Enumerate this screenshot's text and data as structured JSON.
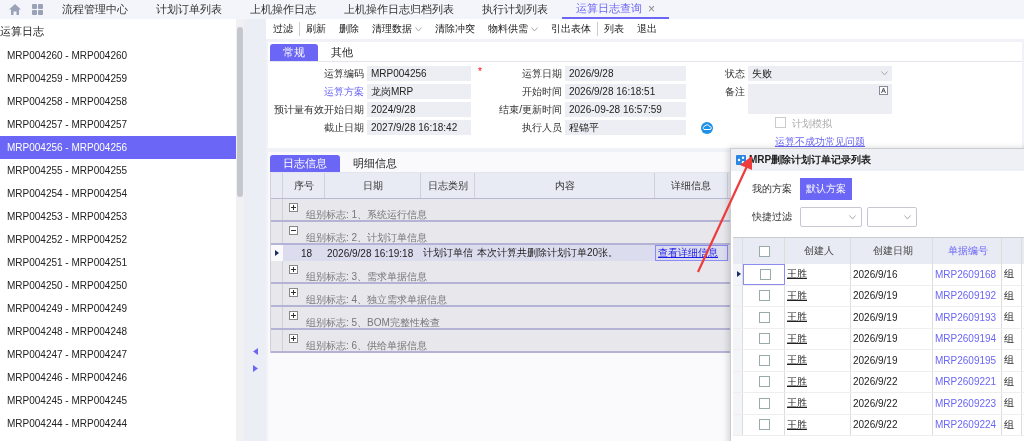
{
  "top_tabs": [
    {
      "label": "流程管理中心",
      "selected": false
    },
    {
      "label": "计划订单列表",
      "selected": false
    },
    {
      "label": "上机操作日志",
      "selected": false
    },
    {
      "label": "上机操作日志归档列表",
      "selected": false
    },
    {
      "label": "执行计划列表",
      "selected": false
    },
    {
      "label": "运算日志查询",
      "selected": true,
      "close": "×"
    }
  ],
  "toolbar": [
    {
      "label": "过滤",
      "dropdown": false,
      "separator_before": false
    },
    {
      "label": "刷新",
      "dropdown": false,
      "separator_before": true
    },
    {
      "label": "删除",
      "dropdown": false,
      "separator_before": false
    },
    {
      "label": "清理数据",
      "dropdown": true,
      "separator_before": false
    },
    {
      "label": "清除冲突",
      "dropdown": false,
      "separator_before": false
    },
    {
      "label": "物料供需",
      "dropdown": true,
      "separator_before": false
    },
    {
      "label": "引出表体",
      "dropdown": false,
      "separator_before": false
    },
    {
      "label": "列表",
      "dropdown": false,
      "separator_before": true
    },
    {
      "label": "退出",
      "dropdown": false,
      "separator_before": false
    }
  ],
  "sidebar": {
    "title": "运算日志",
    "items": [
      {
        "label": "MRP004260 - MRP004260",
        "selected": false
      },
      {
        "label": "MRP004259 - MRP004259",
        "selected": false
      },
      {
        "label": "MRP004258 - MRP004258",
        "selected": false
      },
      {
        "label": "MRP004257 - MRP004257",
        "selected": false
      },
      {
        "label": "MRP004256 - MRP004256",
        "selected": true
      },
      {
        "label": "MRP004255 - MRP004255",
        "selected": false
      },
      {
        "label": "MRP004254 - MRP004254",
        "selected": false
      },
      {
        "label": "MRP004253 - MRP004253",
        "selected": false
      },
      {
        "label": "MRP004252 - MRP004252",
        "selected": false
      },
      {
        "label": "MRP004251 - MRP004251",
        "selected": false
      },
      {
        "label": "MRP004250 - MRP004250",
        "selected": false
      },
      {
        "label": "MRP004249 - MRP004249",
        "selected": false
      },
      {
        "label": "MRP004248 - MRP004248",
        "selected": false
      },
      {
        "label": "MRP004247 - MRP004247",
        "selected": false
      },
      {
        "label": "MRP004246 - MRP004246",
        "selected": false
      },
      {
        "label": "MRP004245 - MRP004245",
        "selected": false
      },
      {
        "label": "MRP004244 - MRP004244",
        "selected": false
      }
    ]
  },
  "form_tabs": [
    {
      "label": "常规",
      "selected": true
    },
    {
      "label": "其他",
      "selected": false
    }
  ],
  "form_columns": [
    [
      {
        "kind": "text",
        "label": "运算编码",
        "value": "MRP004256",
        "required_mark": "*"
      },
      {
        "kind": "text",
        "label": "运算方案",
        "value": "龙岗MRP",
        "link": true
      },
      {
        "kind": "text",
        "label": "预计量有效开始日期",
        "value": "2024/9/28"
      },
      {
        "kind": "text",
        "label": "截止日期",
        "value": "2027/9/28 16:18:42"
      }
    ],
    [
      {
        "kind": "text",
        "label": "运算日期",
        "value": "2026/9/28"
      },
      {
        "kind": "text",
        "label": "开始时间",
        "value": "2026/9/28 16:18:51"
      },
      {
        "kind": "text",
        "label": "结束/更新时间",
        "value": "2026-09-28 16:57:59"
      },
      {
        "kind": "lookup",
        "label": "执行人员",
        "value": "程锦平"
      }
    ],
    [
      {
        "kind": "select",
        "label": "状态",
        "value": "失败"
      },
      {
        "kind": "textarea",
        "label": "备注"
      },
      {
        "kind": "checkbox",
        "label": "计划模拟",
        "checked": false,
        "disabled": true
      },
      {
        "kind": "link",
        "label": "运算不成功常见问题"
      }
    ]
  ],
  "log_tabs": [
    {
      "label": "日志信息",
      "selected": true
    },
    {
      "label": "明细信息",
      "selected": false
    }
  ],
  "log_table": {
    "columns": [
      "序号",
      "日期",
      "日志类别",
      "内容",
      "详细信息"
    ],
    "groups": [
      {
        "label": "组别标志: 1、系统运行信息",
        "expanded": false
      },
      {
        "label": "组别标志: 2、计划订单信息",
        "expanded": true,
        "rows": [
          {
            "seq": "18",
            "date": "2026/9/28 16:19:18",
            "category": "计划订单信",
            "content": "本次计算共删除计划订单20张。",
            "detail": "查看详细信息",
            "current": true
          }
        ]
      },
      {
        "label": "组别标志: 3、需求单据信息",
        "expanded": false
      },
      {
        "label": "组别标志: 4、独立需求单据信息",
        "expanded": false
      },
      {
        "label": "组别标志: 5、BOM完整性检查",
        "expanded": false
      },
      {
        "label": "组别标志: 6、供给单据信息",
        "expanded": false
      }
    ]
  },
  "popup": {
    "title": "MRP删除计划订单记录列表",
    "scheme_label": "我的方案",
    "schemes": [
      {
        "label": "默认方案",
        "selected": true
      }
    ],
    "quick_filter_label": "快捷过滤",
    "columns": [
      "创建人",
      "创建日期",
      "单据编号"
    ],
    "select_all_checked": false,
    "rows": [
      {
        "creator": "王胜",
        "date": "2026/9/16",
        "number": "MRP2609168",
        "column_5": "组",
        "checked": false,
        "current": true
      },
      {
        "creator": "王胜",
        "date": "2026/9/19",
        "number": "MRP2609192",
        "column_5": "组",
        "checked": false,
        "current": false
      },
      {
        "creator": "王胜",
        "date": "2026/9/19",
        "number": "MRP2609193",
        "column_5": "组",
        "checked": false,
        "current": false
      },
      {
        "creator": "王胜",
        "date": "2026/9/19",
        "number": "MRP2609194",
        "column_5": "组",
        "checked": false,
        "current": false
      },
      {
        "creator": "王胜",
        "date": "2026/9/19",
        "number": "MRP2609195",
        "column_5": "组",
        "checked": false,
        "current": false
      },
      {
        "creator": "王胜",
        "date": "2026/9/22",
        "number": "MRP2609221",
        "column_5": "组",
        "checked": false,
        "current": false
      },
      {
        "creator": "王胜",
        "date": "2026/9/22",
        "number": "MRP2609223",
        "column_5": "组",
        "checked": false,
        "current": false
      },
      {
        "creator": "王胜",
        "date": "2026/9/22",
        "number": "MRP2609224",
        "column_5": "组",
        "checked": false,
        "current": false
      }
    ]
  }
}
